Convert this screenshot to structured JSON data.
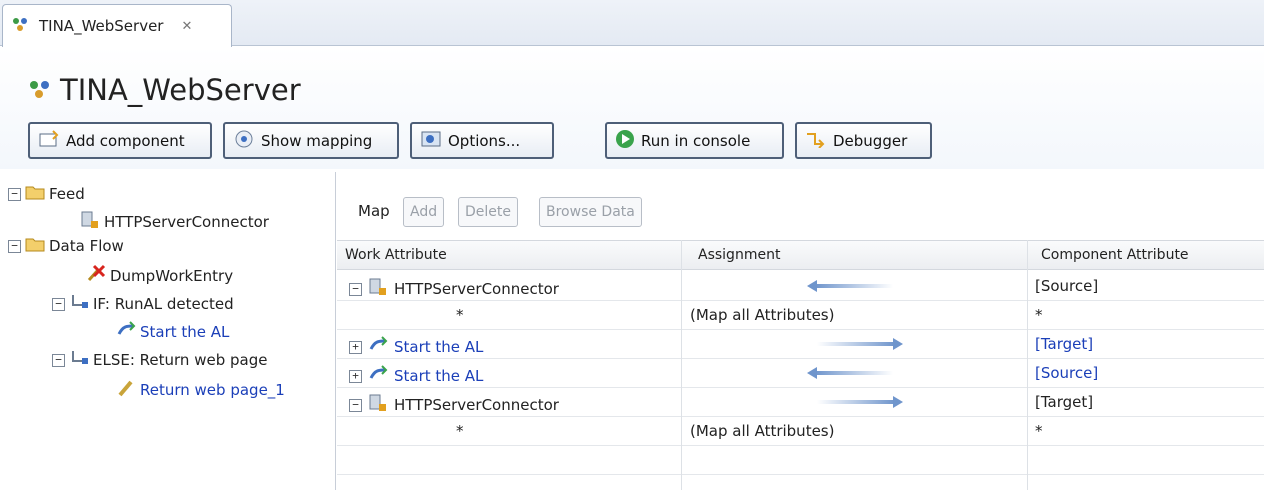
{
  "tab": {
    "title": "TINA_WebServer",
    "close": "✕"
  },
  "header": {
    "title": "TINA_WebServer"
  },
  "toolbar": {
    "add_component": "Add component",
    "show_mapping": "Show mapping",
    "options": "Options...",
    "run_in_console": "Run in console",
    "debugger": "Debugger"
  },
  "tree": {
    "feed": "Feed",
    "http_connector": "HTTPServerConnector",
    "data_flow": "Data Flow",
    "dump": "DumpWorkEntry",
    "if_branch": "IF: RunAL detected",
    "start_al": "Start the AL",
    "else_branch": "ELSE: Return web page",
    "return_page": "Return web page_1"
  },
  "mapbar": {
    "label": "Map",
    "add": "Add",
    "delete": "Delete",
    "browse": "Browse Data"
  },
  "grid": {
    "headers": [
      "Work Attribute",
      "Assignment",
      "Component Attribute"
    ],
    "rows": [
      {
        "name": "HTTPServerConnector",
        "assign": "",
        "component": "[Source]"
      },
      {
        "name": "*",
        "assign": "(Map all Attributes)",
        "component": "*"
      },
      {
        "name": "Start the AL",
        "assign": "",
        "component": "[Target]"
      },
      {
        "name": "Start the AL",
        "assign": "",
        "component": "[Source]"
      },
      {
        "name": "HTTPServerConnector",
        "assign": "",
        "component": "[Target]"
      },
      {
        "name": "*",
        "assign": "(Map all Attributes)",
        "component": "*"
      }
    ]
  },
  "colors": {
    "link": "#1b3fb8",
    "arrow": "#6f95cc"
  }
}
